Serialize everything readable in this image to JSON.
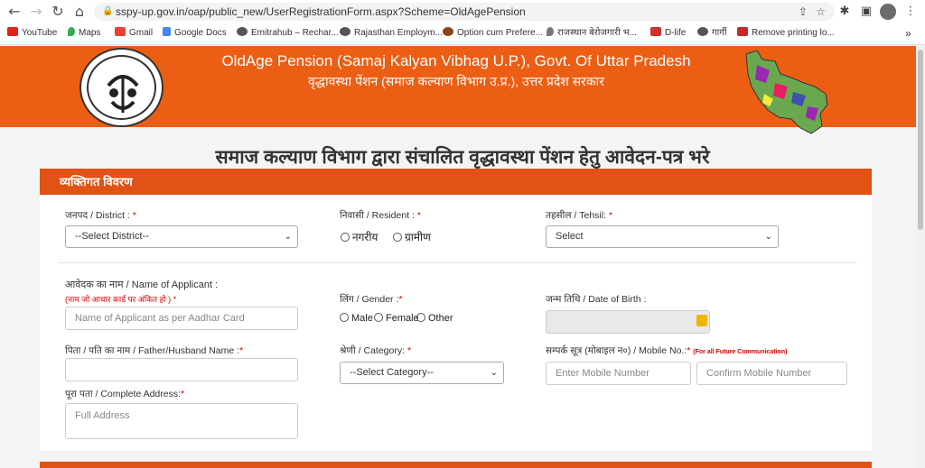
{
  "browser": {
    "url": "sspy-up.gov.in/oap/public_new/UserRegistrationForm.aspx?Scheme=OldAgePension",
    "bookmarks": [
      "YouTube",
      "Maps",
      "Gmail",
      "Google Docs",
      "Emitrahub – Rechar...",
      "Rajasthan Employm...",
      "Option cum Prefere...",
      "राजस्थान बेरोजगारी भ...",
      "D-life",
      "गार्गी",
      "Remove printing lo..."
    ],
    "more": "»"
  },
  "header": {
    "title": "OldAge Pension (Samaj Kalyan Vibhag U.P.), Govt. Of Uttar Pradesh",
    "subtitle": "वृद्धावस्था पेंशन (समाज कल्याण विभाग उ.प्र.), उत्तर प्रदेश सरकार",
    "logo_text": "उत्तर प्रदेश सरकार"
  },
  "page_title": "समाज कल्याण विभाग द्वारा संचालित वृद्धावस्था पेंशन हेतु आवेदन-पत्र भरे",
  "section": {
    "title": "व्यक्तिगत विवरण"
  },
  "form": {
    "district_label": "जनपद / District :",
    "district_value": "--Select District--",
    "resident_label": "निवासी / Resident :",
    "resident_urban": "नगरीय",
    "resident_rural": "ग्रामीण",
    "tehsil_label": "तहसील / Tehsil:",
    "tehsil_value": "Select",
    "applicant_label": "आवेदक का नाम / Name of Applicant :",
    "applicant_note": "(नाम जो आधार कार्ड पर अंकित हो )",
    "applicant_placeholder": "Name of Applicant as per Aadhar Card",
    "gender_label": "लिंग / Gender :",
    "gender_male": "Male",
    "gender_female": "Female",
    "gender_other": "Other",
    "dob_label": "जन्म तिथि / Date of Birth :",
    "father_label": "पिता / पति का नाम / Father/Husband Name :",
    "category_label": "श्रेणी / Category:",
    "category_value": "--Select Category--",
    "mobile_label": "सम्पर्क सूत्र (मोबाइल न०) / Mobile No.:",
    "mobile_note": "(For all Future Communication)",
    "mobile_placeholder": "Enter Mobile Number",
    "confirm_mobile_placeholder": "Confirm Mobile Number",
    "address_label": "पूरा पता / Complete Address:",
    "address_placeholder": "Full Address",
    "required_mark": "*"
  }
}
